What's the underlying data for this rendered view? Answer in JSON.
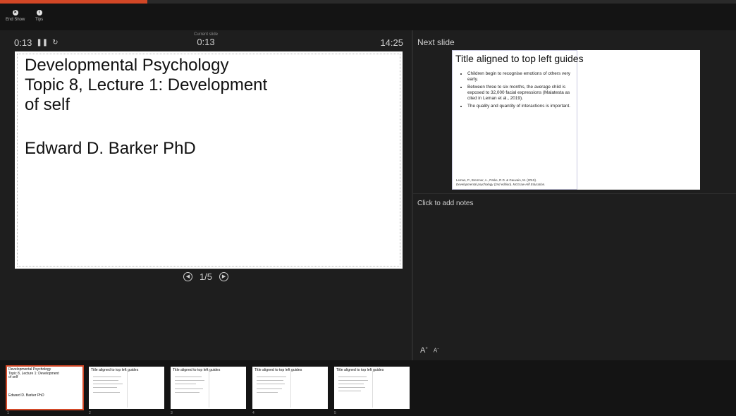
{
  "progress": {
    "fraction": 0.2
  },
  "toolbar": {
    "end_show_label": "End Show",
    "tips_label": "Tips",
    "end_show_icon": "close-circle-icon",
    "tips_icon": "info-circle-icon"
  },
  "presenter": {
    "elapsed": "0:13",
    "current_slide_label": "Current slide",
    "current_slide_time": "0:13",
    "clock": "14:25",
    "next_slide_label": "Next slide",
    "notes_placeholder": "Click to add notes",
    "slide_counter": "1/5",
    "font_increase": "A",
    "font_decrease": "A"
  },
  "current_slide": {
    "title_lines": [
      "Developmental Psychology",
      "Topic 8, Lecture 1: Development",
      "of self"
    ],
    "author": "Edward D. Barker PhD"
  },
  "next_slide": {
    "title": "Title aligned to top left guides",
    "bullets": [
      "Children begin to recognise emotions of others very early.",
      "Between three to six months, the average child is exposed to 32,000 facial expressions (Malatesta as cited in Leman et al., 2019).",
      "The quality and quantity of interactions is important."
    ],
    "reference_line1": "Leman, P., Bremner, A., Parke, R.D. & Gauvain, M. (2019).",
    "reference_line2": "Developmental psychology (2nd edition). McGraw-Hill Education."
  },
  "thumbnails": [
    {
      "number": "1",
      "line1": "Developmental Psychology",
      "line2": "Topic 8, Lecture 1: Development",
      "line3": "of self",
      "author": "Edward D. Barker PhD",
      "selected": true
    },
    {
      "number": "2",
      "title": "Title aligned to top left guides"
    },
    {
      "number": "3",
      "title": "Title aligned to top left guides"
    },
    {
      "number": "4",
      "title": "Title aligned to top left guides"
    },
    {
      "number": "5",
      "title": "Title aligned to top left guides"
    }
  ],
  "colors": {
    "accent": "#d24726",
    "background": "#1e1e1e",
    "strip": "#141414"
  }
}
